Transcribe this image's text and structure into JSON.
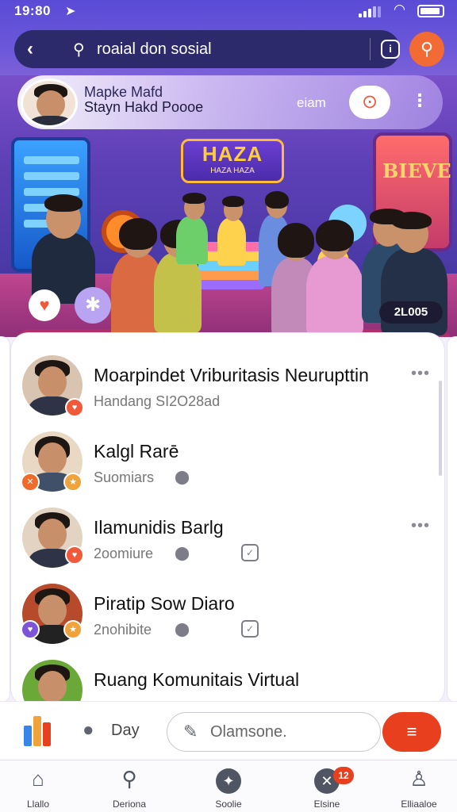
{
  "status_bar": {
    "time": "19:80"
  },
  "search": {
    "query": "roaial don sosial"
  },
  "host": {
    "name": "Mapke Mafd",
    "subtitle": "Stayn Hakd Poooe",
    "badge": "eiam"
  },
  "hero": {
    "sign_text": "HAZA",
    "sign_subtext": "HAZA HAZA",
    "right_screen_text": "BIEVE",
    "viewer_count": "2L005"
  },
  "list": [
    {
      "title": "Moarpindet Vriburitasis Neurupttin",
      "subtitle": "Handang SI2O28ad",
      "avatar_color": "#d8c4b0"
    },
    {
      "title": "Kalgl Rarē",
      "subtitle": "Suomiars",
      "avatar_color": "#e9d8c4"
    },
    {
      "title": "Ilamunidis Barlg",
      "subtitle": "2oomiure",
      "avatar_color": "#e3d3c2"
    },
    {
      "title": "Piratip Sow Diaro",
      "subtitle": "2nohibite",
      "avatar_color": "#b84a2c"
    },
    {
      "title": "Ruang Komunitais Virtual",
      "subtitle": "",
      "avatar_color": "#6aa838"
    }
  ],
  "composer": {
    "day_label": "Day",
    "placeholder": "Olamsone."
  },
  "nav": {
    "items": [
      {
        "label": "Llallo",
        "icon": "home-icon"
      },
      {
        "label": "Deriona",
        "icon": "search-icon"
      },
      {
        "label": "Soolie",
        "icon": "sparkle-icon"
      },
      {
        "label": "Elsine",
        "icon": "close-circle-icon",
        "badge": "12"
      },
      {
        "label": "Elliaaloe",
        "icon": "profile-icon"
      }
    ]
  },
  "colors": {
    "header": "#5a4bd6",
    "accent": "#e8401f",
    "orange_button": "#f26a34"
  }
}
